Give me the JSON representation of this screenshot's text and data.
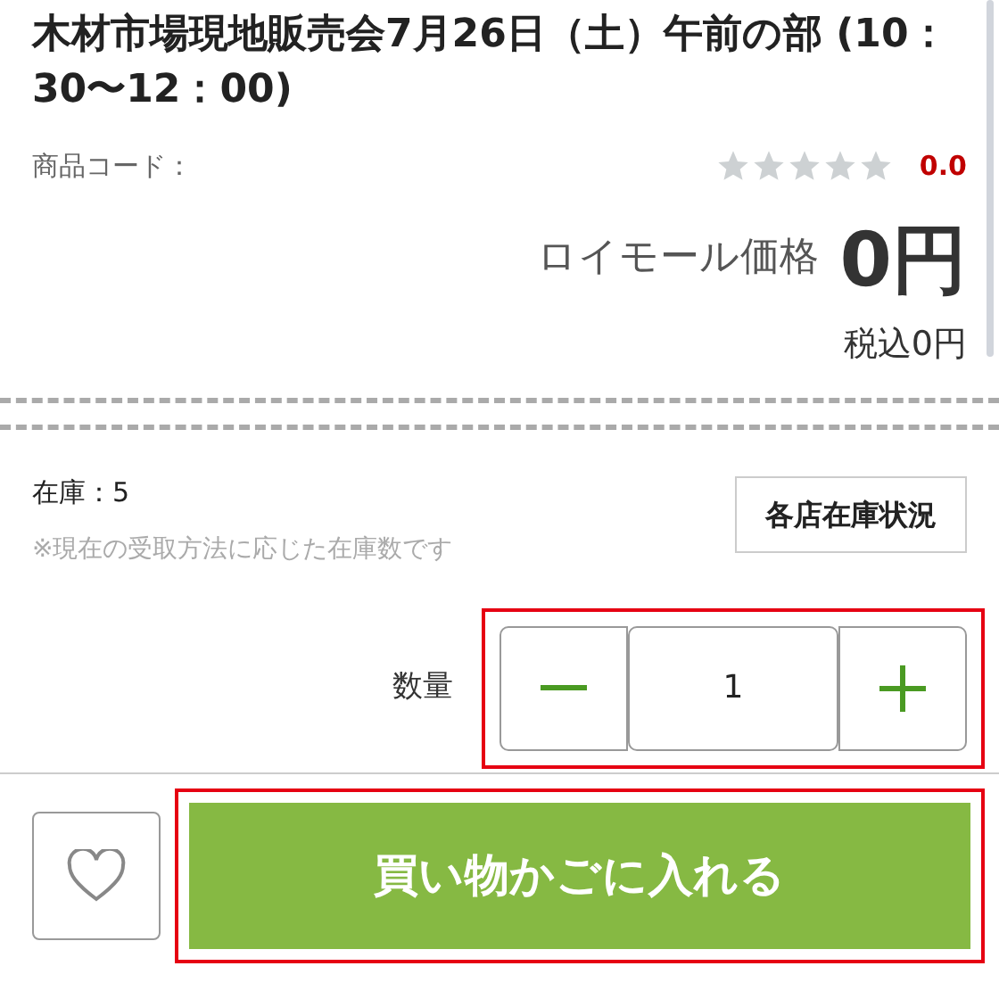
{
  "product": {
    "title": "木材市場現地販売会7月26日（土）午前の部 (10：30〜12：00)",
    "code_label": "商品コード：",
    "stars": 0,
    "rating": "0.0",
    "price_label": "ロイモール価格",
    "price": "0円",
    "tax_included": "税込0円"
  },
  "stock": {
    "text": "在庫：5",
    "note": "※現在の受取方法に応じた在庫数です",
    "button": "各店在庫状況"
  },
  "quantity": {
    "label": "数量",
    "value": "1",
    "highlighted": true
  },
  "cart": {
    "favorite": false,
    "button": "買い物かごに入れる",
    "highlighted": true
  }
}
